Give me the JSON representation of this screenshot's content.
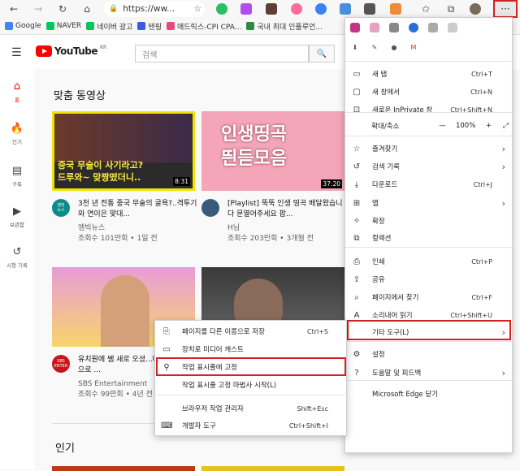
{
  "browser": {
    "url": "https://ww...",
    "bookmarks": [
      {
        "label": "Google",
        "color": "#4285f4"
      },
      {
        "label": "NAVER",
        "color": "#03c75a"
      },
      {
        "label": "네이버 광고",
        "color": "#03c75a"
      },
      {
        "label": "텐핑",
        "color": "#3b5bdb"
      },
      {
        "label": "애드릭스-CPI CPA...",
        "color": "#e64980"
      },
      {
        "label": "국내 최대 인플루언...",
        "color": "#2b8a3e"
      }
    ],
    "more_label": "···"
  },
  "youtube": {
    "logo_text": "YouTube",
    "logo_region": "KR",
    "search_placeholder": "검색",
    "nav": [
      {
        "icon": "home-icon",
        "label": "홈"
      },
      {
        "icon": "trending-icon",
        "label": "인기"
      },
      {
        "icon": "subscriptions-icon",
        "label": "구독"
      },
      {
        "icon": "library-icon",
        "label": "보관함"
      },
      {
        "icon": "history-icon",
        "label": "시청 기록"
      }
    ],
    "section_recommended": "맞춤 동영상",
    "section_trending": "인기",
    "videos": [
      {
        "thumb_text": "중국 무술이 사기라고?\n드루와~ 맞짱떴더니..",
        "duration": "8:31",
        "title": "3천 년 전통 중국 무술의 굴욕?..격투기와 연이은 맞대...",
        "channel": "엠빅뉴스",
        "meta": "조회수 101만회 • 1일 전",
        "avatar_text": "엠빅\n뉴스"
      },
      {
        "thumb_text": "인생띵곡\n띈듣모음",
        "duration": "37:20",
        "title": "[Playlist] 뚝뚝 인생 띵곡 배달왔습니다 문열어주세요 팝...",
        "channel": "H님",
        "meta": "조회수 203만회 • 3개월 전",
        "avatar_text": ""
      },
      {
        "thumb_text": "",
        "duration": "",
        "title": "유치원에 쌤 새로 오셨...대로 모셔라 앞으로 ...",
        "channel": "SBS Entertainment",
        "meta": "조회수 99만회 • 4년 전",
        "avatar_text": "SBS\nENTER"
      },
      {
        "thumb_text": "",
        "duration": "",
        "title": "",
        "channel": "",
        "meta": "",
        "avatar_text": ""
      }
    ]
  },
  "edge_menu": {
    "items": [
      {
        "icon": "new-tab-icon",
        "label": "새 탭",
        "shortcut": "Ctrl+T",
        "arrow": false
      },
      {
        "icon": "new-window-icon",
        "label": "새 창에서",
        "shortcut": "Ctrl+N",
        "arrow": false
      },
      {
        "icon": "inprivate-icon",
        "label": "새로운 InPrivate 창",
        "shortcut": "Ctrl+Shift+N",
        "arrow": false
      },
      {
        "icon": "favorites-icon",
        "label": "즐겨찾기",
        "shortcut": "",
        "arrow": true
      },
      {
        "icon": "history-icon",
        "label": "검색 기록",
        "shortcut": "",
        "arrow": true
      },
      {
        "icon": "download-icon",
        "label": "다운로드",
        "shortcut": "Ctrl+J",
        "arrow": false
      },
      {
        "icon": "apps-icon",
        "label": "앱",
        "shortcut": "",
        "arrow": true
      },
      {
        "icon": "extensions-icon",
        "label": "확장",
        "shortcut": "",
        "arrow": false
      },
      {
        "icon": "collections-icon",
        "label": "컬렉션",
        "shortcut": "",
        "arrow": false
      },
      {
        "icon": "print-icon",
        "label": "인쇄",
        "shortcut": "Ctrl+P",
        "arrow": false
      },
      {
        "icon": "share-icon",
        "label": "공유",
        "shortcut": "",
        "arrow": false
      },
      {
        "icon": "find-icon",
        "label": "페이지에서 찾기",
        "shortcut": "Ctrl+F",
        "arrow": false
      },
      {
        "icon": "read-aloud-icon",
        "label": "소리내어 읽기",
        "shortcut": "Ctrl+Shift+U",
        "arrow": false
      },
      {
        "icon": "",
        "label": "기타 도구(L)",
        "shortcut": "",
        "arrow": true
      },
      {
        "icon": "settings-icon",
        "label": "설정",
        "shortcut": "",
        "arrow": false
      },
      {
        "icon": "help-icon",
        "label": "도움말 및 피드백",
        "shortcut": "",
        "arrow": true
      },
      {
        "icon": "",
        "label": "Microsoft Edge 닫기",
        "shortcut": "",
        "arrow": false
      }
    ],
    "zoom_label": "확대/축소",
    "zoom_value": "100%",
    "zoom_minus": "—",
    "zoom_plus": "+"
  },
  "sub_menu": {
    "items": [
      {
        "icon": "save-page-icon",
        "label": "페이지를 다른 이름으로 저장",
        "shortcut": "Ctrl+S"
      },
      {
        "icon": "cast-icon",
        "label": "장치로 미디어 캐스트",
        "shortcut": ""
      },
      {
        "icon": "pin-icon",
        "label": "작업 표시줄에 고정",
        "shortcut": ""
      },
      {
        "icon": "",
        "label": "작업 표시줄 고정 마법사 시작(L)",
        "shortcut": ""
      },
      {
        "icon": "",
        "label": "브라우저 작업 관리자",
        "shortcut": "Shift+Esc"
      },
      {
        "icon": "devtools-icon",
        "label": "개발자 도구",
        "shortcut": "Ctrl+Shift+I"
      }
    ]
  },
  "colors": {
    "highlight": "#d42121",
    "youtube_red": "#ff0000"
  }
}
